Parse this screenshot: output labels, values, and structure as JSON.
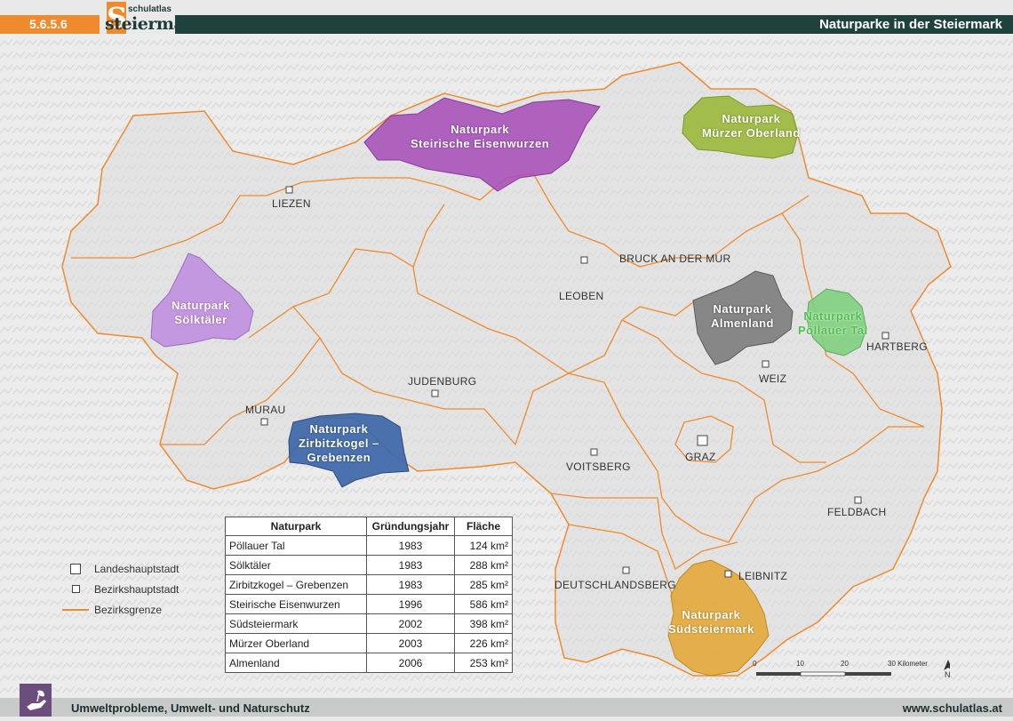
{
  "header": {
    "code": "5.6.5.6",
    "logo_top": "schulatlas",
    "logo_bottom": "steiermark",
    "logo_letter": "S",
    "title": "Naturparke in der Steiermark"
  },
  "cities": [
    {
      "name": "LIEZEN"
    },
    {
      "name": "BRUCK AN DER MUR"
    },
    {
      "name": "LEOBEN"
    },
    {
      "name": "HARTBERG"
    },
    {
      "name": "WEIZ"
    },
    {
      "name": "JUDENBURG"
    },
    {
      "name": "MURAU"
    },
    {
      "name": "VOITSBERG"
    },
    {
      "name": "GRAZ"
    },
    {
      "name": "FELDBACH"
    },
    {
      "name": "LEIBNITZ"
    },
    {
      "name": "DEUTSCHLANDSBERG"
    }
  ],
  "parks": {
    "eisenwurzen": {
      "line1": "Naturpark",
      "line2": "Steirische Eisenwurzen",
      "color": "#a74fb8"
    },
    "muerzer": {
      "line1": "Naturpark",
      "line2": "Mürzer Oberland",
      "color": "#9ab83a"
    },
    "soelktaeler": {
      "line1": "Naturpark",
      "line2": "Sölktäler",
      "color": "#c08ee0"
    },
    "almenland": {
      "line1": "Naturpark",
      "line2": "Almenland",
      "color": "#7f7f7f"
    },
    "poellauer": {
      "line1": "Naturpark",
      "line2": "Pöllauer Tal",
      "color": "#7fcf7f"
    },
    "zirbitz": {
      "line1": "Naturpark",
      "line2": "Zirbitzkogel –",
      "line3": "Grebenzen",
      "color": "#3d67a8"
    },
    "suedsteiermark": {
      "line1": "Naturpark",
      "line2": "Südsteiermark",
      "color": "#e3a83a"
    }
  },
  "legend": {
    "landeshauptstadt": "Landeshauptstadt",
    "bezirkshauptstadt": "Bezirkshauptstadt",
    "bezirksgrenze": "Bezirksgrenze"
  },
  "table": {
    "headers": [
      "Naturpark",
      "Gründungsjahr",
      "Fläche"
    ],
    "rows": [
      [
        "Pöllauer Tal",
        "1983",
        "124 km²"
      ],
      [
        "Sölktäler",
        "1983",
        "288 km²"
      ],
      [
        "Zirbitzkogel – Grebenzen",
        "1983",
        "285 km²"
      ],
      [
        "Steirische Eisenwurzen",
        "1996",
        "586 km²"
      ],
      [
        "Südsteiermark",
        "2002",
        "398 km²"
      ],
      [
        "Mürzer Oberland",
        "2003",
        "226 km²"
      ],
      [
        "Almenland",
        "2006",
        "253 km²"
      ]
    ]
  },
  "scale": {
    "ticks": [
      "0",
      "10",
      "20",
      "30 Kilometer"
    ],
    "north": "N"
  },
  "footer": {
    "left": "Umweltprobleme, Umwelt- und Naturschutz",
    "right": "www.schulatlas.at"
  },
  "colors": {
    "border": "#ef8a2f",
    "header_dark": "#20423f",
    "header_orange": "#ef8a2f"
  }
}
